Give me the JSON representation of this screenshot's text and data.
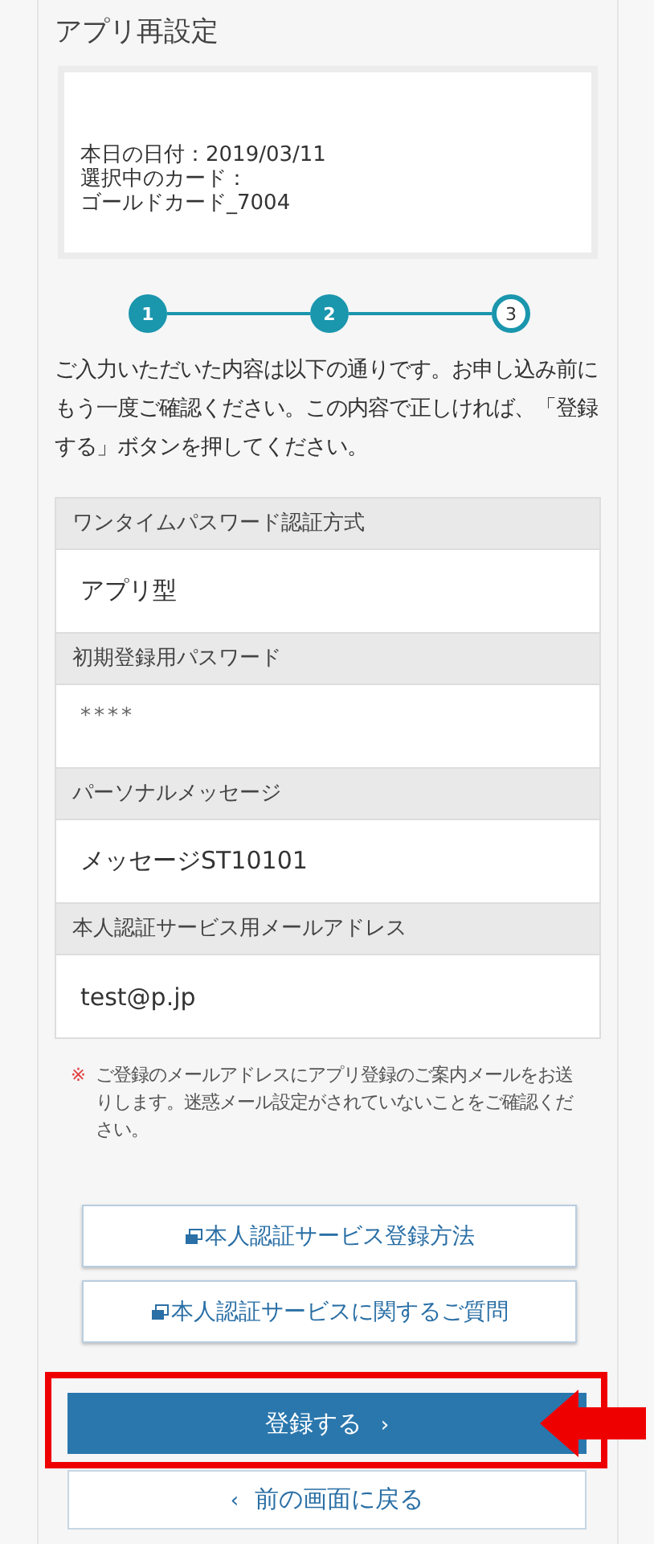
{
  "title": "アプリ再設定",
  "info": {
    "date": "本日の日付：2019/03/11",
    "card_label": "選択中のカード：",
    "card_name": "ゴールドカード_7004"
  },
  "steps": [
    {
      "label": "1",
      "completed": true
    },
    {
      "label": "2",
      "completed": true
    },
    {
      "label": "3",
      "completed": false
    }
  ],
  "description": "ご入力いただいた内容は以下の通りです。お申し込み前にもう一度ご確認ください。この内容で正しければ、「登録する」ボタンを押してください。",
  "fields": [
    {
      "label": "ワンタイムパスワード認証方式",
      "value": "アプリ型",
      "kind": "text"
    },
    {
      "label": "初期登録用パスワード",
      "value": "****",
      "kind": "masked"
    },
    {
      "label": "パーソナルメッセージ",
      "value": "メッセージST10101",
      "kind": "text"
    },
    {
      "label": "本人認証サービス用メールアドレス",
      "value": "test@p.jp",
      "kind": "text"
    }
  ],
  "note": {
    "mark": "※",
    "text": "ご登録のメールアドレスにアプリ登録のご案内メールをお送りします。迷惑メール設定がされていないことをご確認ください。"
  },
  "links": [
    "本人認証サービス登録方法",
    "本人認証サービスに関するご質問"
  ],
  "submit": {
    "label": "登録する",
    "chevron": "›"
  },
  "back": {
    "label": "前の画面に戻る",
    "chevron": "‹"
  }
}
